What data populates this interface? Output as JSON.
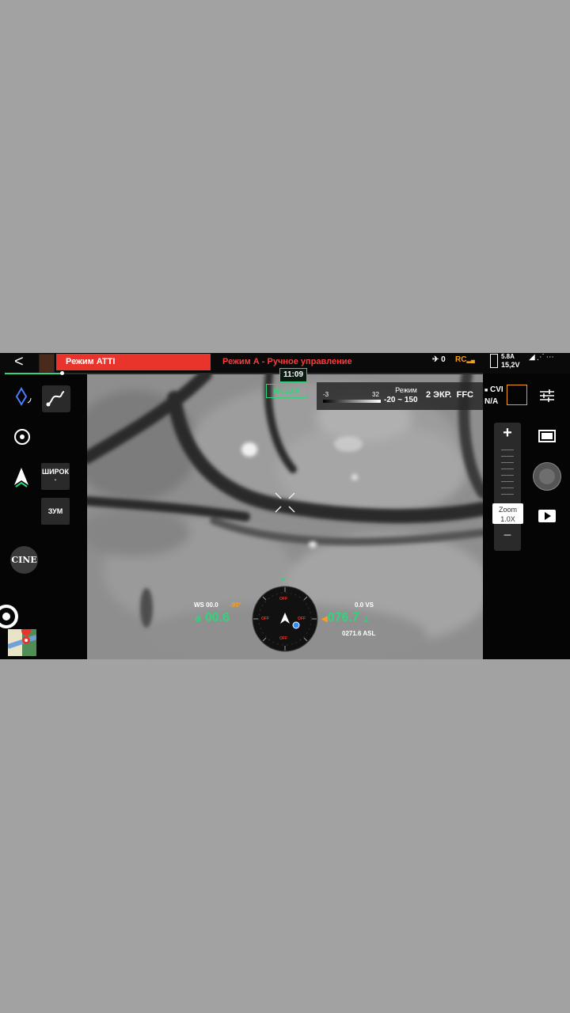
{
  "topbar": {
    "back": "<",
    "mode_atti": "Режим ATTI",
    "mode_a": "Режим А - Ручное управление",
    "satellites": "0",
    "rc": "RC",
    "battery_amp": "5.8A",
    "battery_volt": "15,2V",
    "progress": 0.12
  },
  "overlay": {
    "time": "11:09",
    "ir_zoom": "ИК 2.0X"
  },
  "thermal": {
    "min": "-3",
    "max": "32",
    "mode_label": "Режим",
    "range": "-20 ~ 150",
    "screens": "2 ЭКР.",
    "ffc": "FFC",
    "cvi": "CVI",
    "na": "N/A"
  },
  "left_panel": {
    "wide": "ШИРОК",
    "wide_sub": ".",
    "zoom": "ЗУМ",
    "cine": "CINE"
  },
  "right_panel": {
    "zoom_label": "Zoom",
    "zoom_value": "1.0X",
    "plus": "+",
    "minus": "−"
  },
  "hud": {
    "ws": "WS 00.0",
    "gimbal_pitch": "-90°",
    "speed": "00.6",
    "vs": "0.0  VS",
    "altitude": "076.7",
    "asl": "0271.6 ASL",
    "compass_labels": [
      "OFF",
      "OFF",
      "OFF",
      "OFF"
    ]
  },
  "colors": {
    "accent_green": "#2fd57a",
    "alert_red": "#e8342b",
    "rc_orange": "#f2a01a",
    "pitch_orange": "#ff9a1f"
  }
}
